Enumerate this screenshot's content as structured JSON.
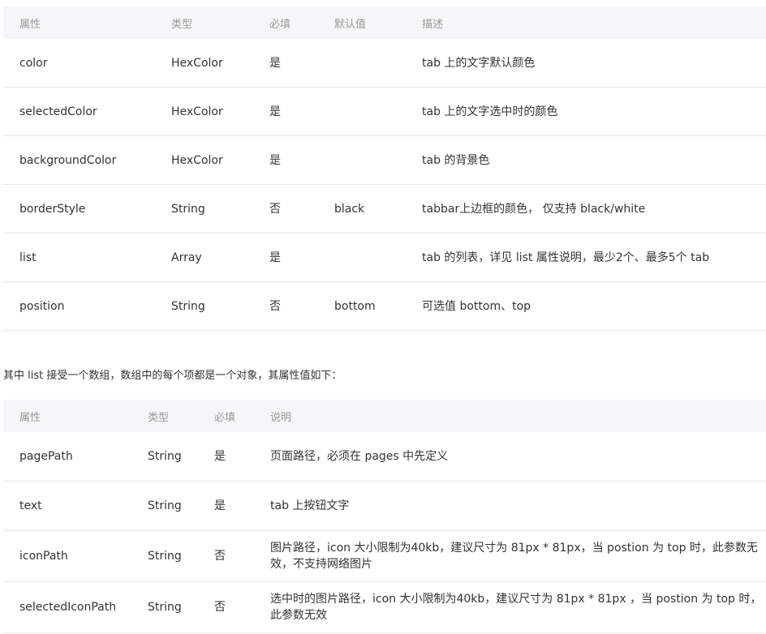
{
  "table1": {
    "headers": [
      "属性",
      "类型",
      "必填",
      "默认值",
      "描述"
    ],
    "rows": [
      [
        "color",
        "HexColor",
        "是",
        "",
        "tab 上的文字默认颜色"
      ],
      [
        "selectedColor",
        "HexColor",
        "是",
        "",
        "tab 上的文字选中时的颜色"
      ],
      [
        "backgroundColor",
        "HexColor",
        "是",
        "",
        "tab 的背景色"
      ],
      [
        "borderStyle",
        "String",
        "否",
        "black",
        "tabbar上边框的颜色， 仅支持 black/white"
      ],
      [
        "list",
        "Array",
        "是",
        "",
        "tab 的列表，详见 list 属性说明，最少2个、最多5个 tab"
      ],
      [
        "position",
        "String",
        "否",
        "bottom",
        "可选值 bottom、top"
      ]
    ]
  },
  "paragraph": "其中 list 接受一个数组，数组中的每个项都是一个对象，其属性值如下：",
  "table2": {
    "headers": [
      "属性",
      "类型",
      "必填",
      "说明"
    ],
    "rows": [
      [
        "pagePath",
        "String",
        "是",
        "页面路径，必须在 pages 中先定义"
      ],
      [
        "text",
        "String",
        "是",
        "tab 上按钮文字"
      ],
      [
        "iconPath",
        "String",
        "否",
        "图片路径，icon 大小限制为40kb，建议尺寸为 81px * 81px，当 postion 为 top 时，此参数无效，不支持网络图片"
      ],
      [
        "selectedIconPath",
        "String",
        "否",
        "选中时的图片路径，icon 大小限制为40kb，建议尺寸为 81px * 81px ，当 postion 为 top 时，此参数无效"
      ]
    ]
  },
  "colors": {
    "header_bg": "#f5f6f7",
    "header_text": "#999999",
    "body_text": "#333333",
    "row_border": "#e8e8e8"
  }
}
